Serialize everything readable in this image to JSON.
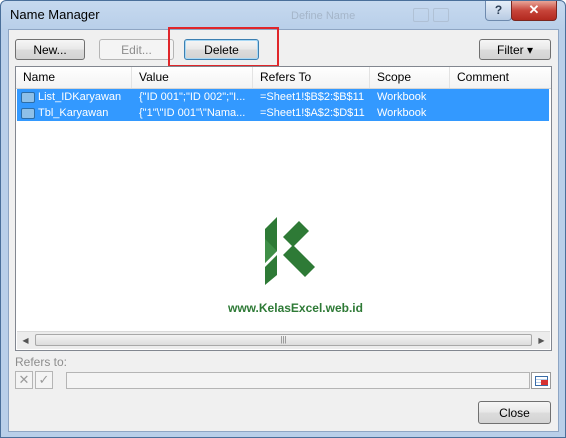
{
  "window": {
    "title": "Name Manager",
    "ghost_title": "Define Name",
    "help_glyph": "?",
    "close_glyph": "✕"
  },
  "toolbar": {
    "new_label": "New...",
    "edit_label": "Edit...",
    "delete_label": "Delete",
    "filter_label": "Filter ▾"
  },
  "list": {
    "columns": [
      "Name",
      "Value",
      "Refers To",
      "Scope",
      "Comment"
    ],
    "rows": [
      {
        "icon": "named-range-icon",
        "name": "List_IDKaryawan",
        "value": "{\"ID 001\";\"ID 002\";\"I...",
        "refers_to": "=Sheet1!$B$2:$B$11",
        "scope": "Workbook",
        "comment": "",
        "selected": true
      },
      {
        "icon": "named-range-icon",
        "name": "Tbl_Karyawan",
        "value": "{\"1\"\\\"ID 001\"\\\"Nama...",
        "refers_to": "=Sheet1!$A$2:$D$11",
        "scope": "Workbook",
        "comment": "",
        "selected": true
      }
    ],
    "scroll_left_glyph": "◀",
    "scroll_right_glyph": "▶",
    "thumb_grip": "|||"
  },
  "watermark": {
    "text": "www.KelasExcel.web.id",
    "logo_icon": "kelasexcel-k-logo",
    "brand_color": "#2e7a36"
  },
  "refers": {
    "label": "Refers to:",
    "value": "",
    "cancel_glyph": "✕",
    "confirm_glyph": "✓"
  },
  "footer": {
    "close_label": "Close"
  },
  "colors": {
    "selection": "#3399ff",
    "highlight_box": "#e0262a",
    "title_bar": "#b9cfe9"
  }
}
